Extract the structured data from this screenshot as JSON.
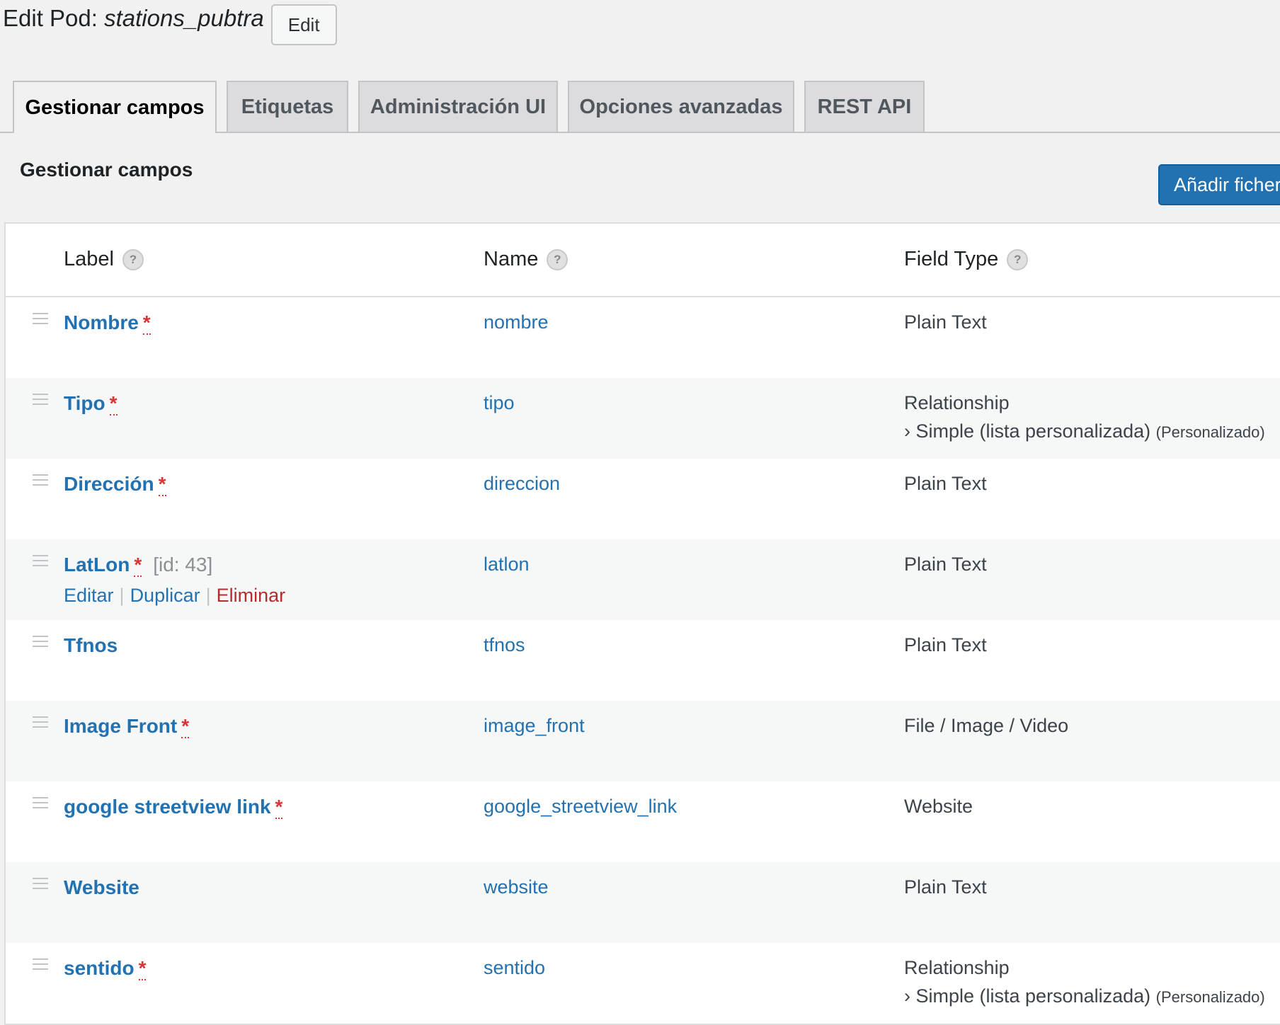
{
  "header": {
    "title_prefix": "Edit Pod: ",
    "pod_name": "stations_pubtra",
    "edit_button": "Edit"
  },
  "tabs": [
    {
      "label": "Gestionar campos",
      "active": true
    },
    {
      "label": "Etiquetas",
      "active": false
    },
    {
      "label": "Administración UI",
      "active": false
    },
    {
      "label": "Opciones avanzadas",
      "active": false
    },
    {
      "label": "REST API",
      "active": false
    }
  ],
  "section": {
    "title": "Gestionar campos",
    "add_button": "Añadir fichero"
  },
  "table": {
    "columns": {
      "label": "Label",
      "name": "Name",
      "field_type": "Field Type",
      "help": "?"
    },
    "required_mark": "*",
    "rows": [
      {
        "label": "Nombre",
        "required": true,
        "name": "nombre",
        "type": "Plain Text",
        "subtype": "",
        "subtype_note": "",
        "id": "",
        "actions": false
      },
      {
        "label": "Tipo",
        "required": true,
        "name": "tipo",
        "type": "Relationship",
        "subtype": "› Simple (lista personalizada)",
        "subtype_note": "(Personalizado)",
        "id": "",
        "actions": false
      },
      {
        "label": "Dirección",
        "required": true,
        "name": "direccion",
        "type": "Plain Text",
        "subtype": "",
        "subtype_note": "",
        "id": "",
        "actions": false
      },
      {
        "label": "LatLon",
        "required": true,
        "name": "latlon",
        "type": "Plain Text",
        "subtype": "",
        "subtype_note": "",
        "id": "[id: 43]",
        "actions": true
      },
      {
        "label": "Tfnos",
        "required": false,
        "name": "tfnos",
        "type": "Plain Text",
        "subtype": "",
        "subtype_note": "",
        "id": "",
        "actions": false
      },
      {
        "label": "Image Front",
        "required": true,
        "name": "image_front",
        "type": "File / Image / Video",
        "subtype": "",
        "subtype_note": "",
        "id": "",
        "actions": false
      },
      {
        "label": "google streetview link",
        "required": true,
        "name": "google_streetview_link",
        "type": "Website",
        "subtype": "",
        "subtype_note": "",
        "id": "",
        "actions": false
      },
      {
        "label": "Website",
        "required": false,
        "name": "website",
        "type": "Plain Text",
        "subtype": "",
        "subtype_note": "",
        "id": "",
        "actions": false
      },
      {
        "label": "sentido",
        "required": true,
        "name": "sentido",
        "type": "Relationship",
        "subtype": "› Simple (lista personalizada)",
        "subtype_note": "(Personalizado)",
        "id": "",
        "actions": false
      }
    ],
    "row_actions": {
      "edit": "Editar",
      "duplicate": "Duplicar",
      "delete": "Eliminar",
      "separator": "|"
    }
  }
}
